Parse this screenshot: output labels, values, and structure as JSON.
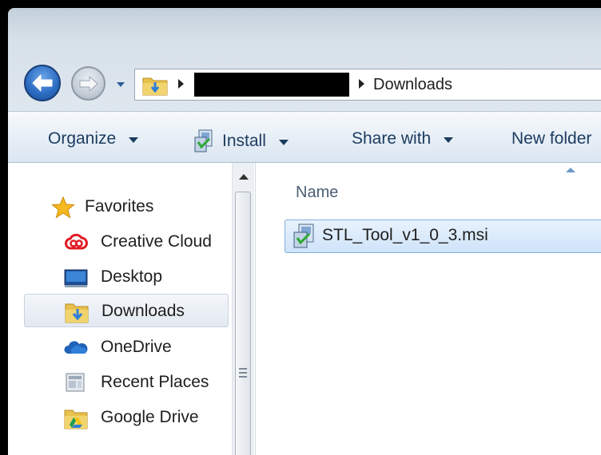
{
  "address": {
    "redacted": true,
    "current_folder": "Downloads"
  },
  "toolbar": {
    "organize": "Organize",
    "install": "Install",
    "share_with": "Share with",
    "new_folder": "New folder"
  },
  "nav": {
    "favorites": "Favorites",
    "items": [
      {
        "label": "Creative Cloud",
        "icon": "creative-cloud-icon"
      },
      {
        "label": "Desktop",
        "icon": "desktop-icon"
      },
      {
        "label": "Downloads",
        "icon": "downloads-folder-icon",
        "selected": true
      },
      {
        "label": "OneDrive",
        "icon": "onedrive-icon"
      },
      {
        "label": "Recent Places",
        "icon": "recent-places-icon"
      },
      {
        "label": "Google Drive",
        "icon": "google-drive-icon"
      }
    ]
  },
  "content": {
    "column_name": "Name",
    "files": [
      {
        "name": "STL_Tool_v1_0_3.msi",
        "icon": "msi-installer-icon",
        "selected": true
      }
    ]
  },
  "colors": {
    "toolbar_text": "#1c3b5f",
    "selection": "#cfe3fa",
    "selection_border": "#84acdd"
  }
}
